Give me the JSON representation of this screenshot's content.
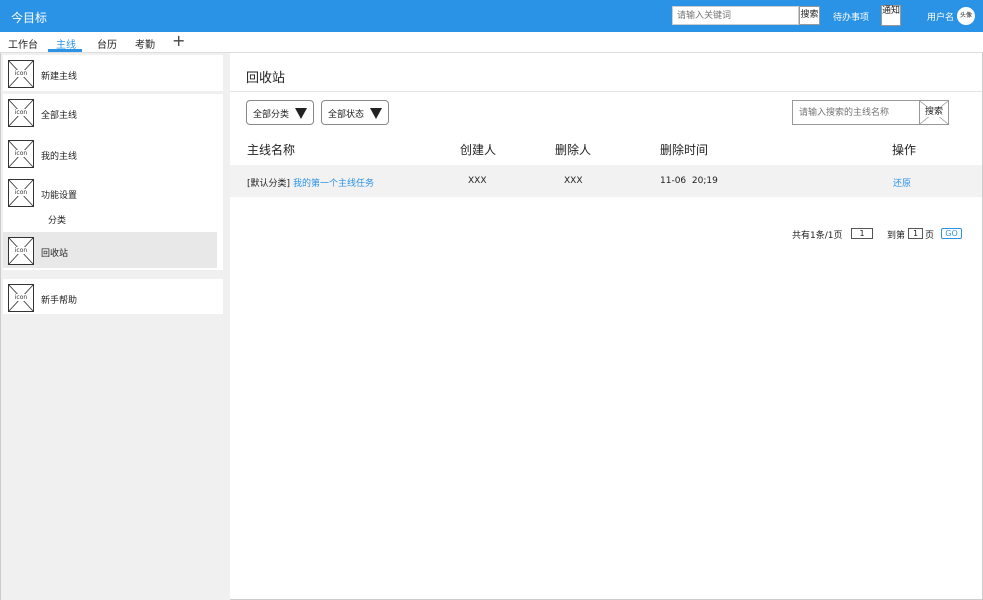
{
  "header": {
    "app_title": "今目标",
    "search_placeholder": "请输入关键词",
    "search_label": "搜索",
    "todo_label": "待办事项",
    "notice_label": "通知",
    "username": "用户名",
    "avatar_label": "头像"
  },
  "tabs": [
    {
      "label": "工作台",
      "active": false
    },
    {
      "label": "主线",
      "active": true
    },
    {
      "label": "台历",
      "active": false
    },
    {
      "label": "考勤",
      "active": false
    }
  ],
  "tab_add_label": "+",
  "sidebar": {
    "icon_placeholder": "icon",
    "items": [
      {
        "label": "新建主线",
        "icon": "placeholder-icon"
      },
      {
        "label": "全部主线",
        "icon": "placeholder-icon"
      },
      {
        "label": "我的主线",
        "icon": "placeholder-icon"
      },
      {
        "label": "功能设置",
        "icon": "placeholder-icon"
      },
      {
        "label": "回收站",
        "icon": "placeholder-icon",
        "selected": true
      },
      {
        "label": "新手帮助",
        "icon": "placeholder-icon"
      }
    ],
    "sub_items": [
      {
        "label": "分类"
      }
    ]
  },
  "main": {
    "title": "回收站",
    "filters": {
      "category": "全部分类",
      "status": "全部状态"
    },
    "name_search_placeholder": "请输入搜索的主线名称",
    "name_search_label": "搜索",
    "table": {
      "headers": [
        "主线名称",
        "创建人",
        "删除人",
        "删除时间",
        "操作"
      ],
      "rows": [
        {
          "category": "[默认分类]",
          "name": "我的第一个主线任务",
          "creator": "XXX",
          "deleter": "XXX",
          "deleted_time": "11-06  20;19",
          "action": "还原"
        }
      ]
    },
    "pagination": {
      "summary": "共有1条/1页",
      "current_page": "1",
      "goto_prefix": "到第",
      "goto_value": "1",
      "goto_suffix": "页",
      "go_label": "GO"
    }
  },
  "colors": {
    "accent": "#2b93e6",
    "sidebar_bg": "#f0f0f0",
    "row_bg": "#f2f2f2"
  }
}
